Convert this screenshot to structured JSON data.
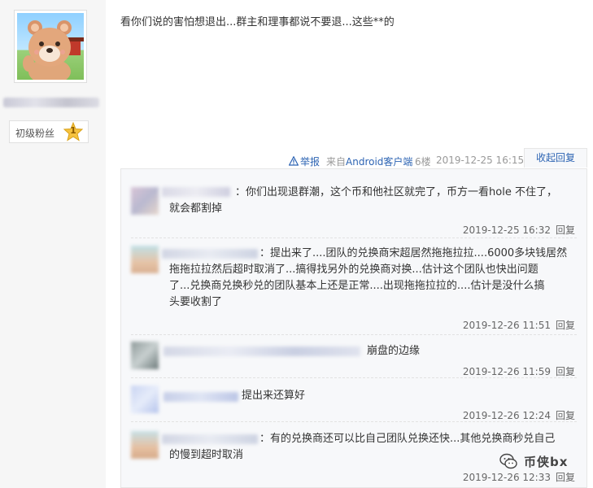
{
  "post": {
    "text": "看你们说的害怕想退出...群主和理事都说不要退...这些**的",
    "fan_badge_label": "初级粉丝",
    "fan_level": "1",
    "report_label": "举报",
    "client_prefix": "来自",
    "client_name": "Android客户端",
    "floor": "6楼",
    "time": "2019-12-25 16:15",
    "collapse_label": "收起回复"
  },
  "comments": [
    {
      "text_lines": [
        "你们出现退群潮，这个币和他社区就完了，币方一看hole 不住了，",
        "就会都割掉"
      ],
      "time": "2019-12-25 16:32",
      "reply": "回复"
    },
    {
      "text_lines": [
        "提出来了....团队的兑换商宋超居然拖拖拉拉....6000多块钱居然",
        "拖拖拉拉然后超时取消了...搞得找另外的兑换商对换...估计这个团队也快出问题",
        "了...兑换商兑换秒兑的团队基本上还是正常....出现拖拖拉拉的....估计是没什么搞",
        "头要收割了"
      ],
      "time": "2019-12-26 11:51",
      "reply": "回复"
    },
    {
      "text_lines": [
        "崩盘的边缘"
      ],
      "time": "2019-12-26 11:59",
      "reply": "回复"
    },
    {
      "text_lines": [
        "提出来还算好"
      ],
      "time": "2019-12-26 12:24",
      "reply": "回复"
    },
    {
      "text_lines": [
        "有的兑换商还可以比自己团队兑换还快...其他兑换商秒兑自己",
        "的慢到超时取消"
      ],
      "time": "2019-12-26 12:33",
      "reply": "回复"
    }
  ],
  "watermark": {
    "text": "币侠bx"
  },
  "colors": {
    "link": "#2d64b3",
    "meta_gray": "#999999",
    "comment_bg": "#f7f8fa",
    "left_bg": "#f6f6f6"
  }
}
